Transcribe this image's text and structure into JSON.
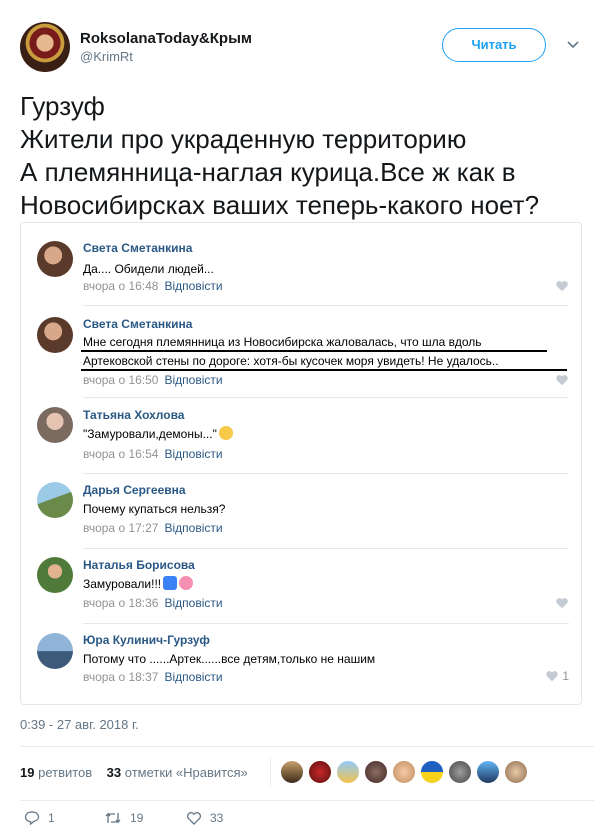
{
  "header": {
    "display_name": "RoksolanaToday&Крым",
    "handle": "@KrimRt",
    "follow_label": "Читать"
  },
  "tweet": {
    "lines": [
      "Гурзуф",
      "Жители про украденную территорию",
      "А племянница-наглая курица.Все ж как в",
      "Новосибирсках ваших теперь-какого ноет?"
    ]
  },
  "comments": [
    {
      "author": "Света Сметанкина",
      "text": [
        "Да.... Обидели людей..."
      ],
      "time": "вчора о 16:48",
      "reply": "Відповісти"
    },
    {
      "author": "Света Сметанкина",
      "text": [
        "Мне сегодня племянница из Новосибирска жаловалась, что шла вдоль",
        "Артековской стены по дороге: хотя-бы кусочек моря увидеть! Не удалось.."
      ],
      "time": "вчора о 16:50",
      "reply": "Відповісти"
    },
    {
      "author": "Татьяна Хохлова",
      "text": [
        "\"Замуровали,демоны...\""
      ],
      "time": "вчора о 16:54",
      "reply": "Відповісти"
    },
    {
      "author": "Дарья Сергеевна",
      "text": [
        "Почему купаться нельзя?"
      ],
      "time": "вчора о 17:27",
      "reply": "Відповісти"
    },
    {
      "author": "Наталья Борисова",
      "text": [
        "Замуровали!!!"
      ],
      "time": "вчора о 18:36",
      "reply": "Відповісти"
    },
    {
      "author": "Юра Кулинич-Гурзуф",
      "text": [
        "Потому что ......Артек......все детям,только не нашим"
      ],
      "time": "вчора о 18:37",
      "reply": "Відповісти",
      "likes": "1"
    }
  ],
  "timestamp": "0:39 - 27 авг. 2018 г.",
  "stats": {
    "retweets_count": "19",
    "retweets_label": "ретвитов",
    "likes_count": "33",
    "likes_label": "отметки «Нравится»"
  },
  "actions": {
    "replies": "1",
    "retweets": "19",
    "likes": "33"
  },
  "colors": {
    "accent": "#1da1f2",
    "vk_link": "#2a5885",
    "muted": "#657786"
  }
}
